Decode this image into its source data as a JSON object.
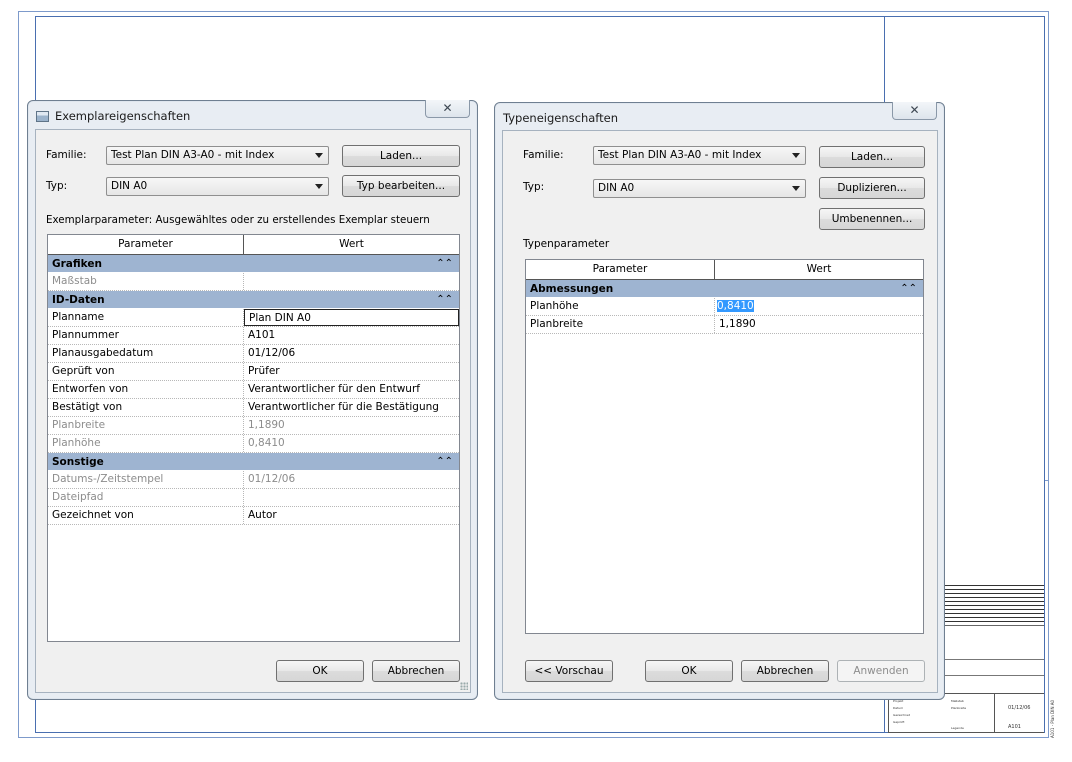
{
  "instance_dialog": {
    "title": "Exemplareigenschaften",
    "close_glyph": "✕",
    "family_label": "Familie:",
    "family_value": "Test Plan DIN A3-A0 - mit Index",
    "type_label": "Typ:",
    "type_value": "DIN A0",
    "load_button": "Laden...",
    "edit_type_button": "Typ bearbeiten...",
    "params_caption": "Exemplarparameter: Ausgewähltes oder zu erstellendes Exemplar steuern",
    "col_parameter": "Parameter",
    "col_value": "Wert",
    "groups": [
      {
        "name": "Grafiken",
        "rows": [
          {
            "param": "Maßstab",
            "value": "",
            "readonly": true
          }
        ]
      },
      {
        "name": "ID-Daten",
        "rows": [
          {
            "param": "Planname",
            "value": "Plan DIN A0",
            "readonly": false,
            "editing": true
          },
          {
            "param": "Plannummer",
            "value": "A101",
            "readonly": false
          },
          {
            "param": "Planausgabedatum",
            "value": "01/12/06",
            "readonly": false
          },
          {
            "param": "Geprüft von",
            "value": "Prüfer",
            "readonly": false
          },
          {
            "param": "Entworfen von",
            "value": "Verantwortlicher für den Entwurf",
            "readonly": false
          },
          {
            "param": "Bestätigt von",
            "value": "Verantwortlicher für die Bestätigung",
            "readonly": false
          },
          {
            "param": "Planbreite",
            "value": "1,1890",
            "readonly": true
          },
          {
            "param": "Planhöhe",
            "value": "0,8410",
            "readonly": true
          }
        ]
      },
      {
        "name": "Sonstige",
        "rows": [
          {
            "param": "Datums-/Zeitstempel",
            "value": "01/12/06",
            "readonly": true
          },
          {
            "param": "Dateipfad",
            "value": "",
            "readonly": true
          },
          {
            "param": "Gezeichnet von",
            "value": "Autor",
            "readonly": false
          }
        ]
      }
    ],
    "collapse_glyph": "⌃⌃",
    "ok_button": "OK",
    "cancel_button": "Abbrechen"
  },
  "type_dialog": {
    "title": "Typeneigenschaften",
    "close_glyph": "✕",
    "family_label": "Familie:",
    "family_value": "Test Plan DIN A3-A0 - mit Index",
    "type_label": "Typ:",
    "type_value": "DIN A0",
    "load_button": "Laden...",
    "duplicate_button": "Duplizieren...",
    "rename_button": "Umbenennen...",
    "params_caption": "Typenparameter",
    "col_parameter": "Parameter",
    "col_value": "Wert",
    "groups": [
      {
        "name": "Abmessungen",
        "rows": [
          {
            "param": "Planhöhe",
            "value": "0,8410",
            "selected": true
          },
          {
            "param": "Planbreite",
            "value": "1,1890",
            "selected": false
          }
        ]
      }
    ],
    "preview_button": "<< Vorschau",
    "ok_button": "OK",
    "cancel_button": "Abbrechen",
    "apply_button": "Anwenden"
  },
  "titleblock": {
    "sheet_number": "A101",
    "sheet_date": "01/12/06"
  },
  "colors": {
    "sheet_border": "#4a6fb0",
    "group_header": "#9eb4d1",
    "selection": "#3399ff"
  }
}
